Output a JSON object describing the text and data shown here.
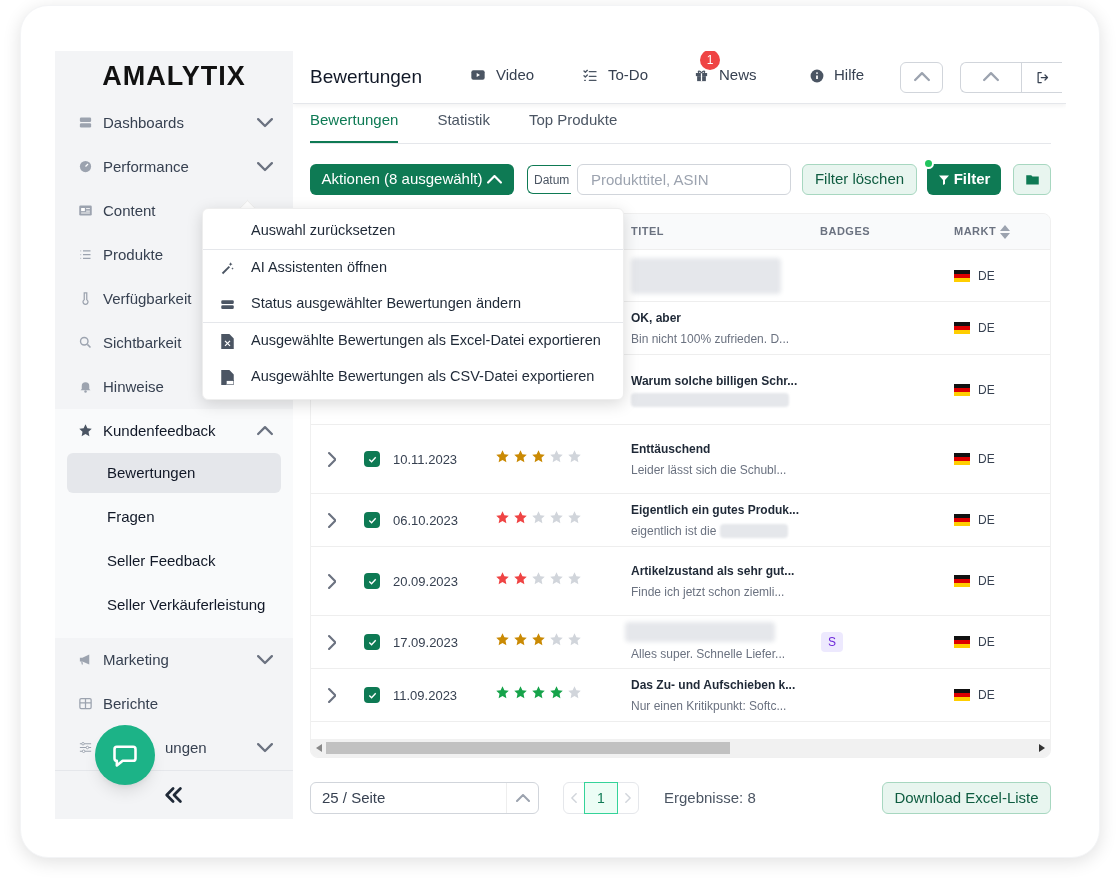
{
  "logo": "AMALYTIX",
  "sidebar": {
    "items": [
      {
        "label": "Dashboards",
        "kind": "group",
        "expanded": false
      },
      {
        "label": "Performance",
        "kind": "group",
        "expanded": false
      },
      {
        "label": "Content",
        "kind": "link"
      },
      {
        "label": "Produkte",
        "kind": "link"
      },
      {
        "label": "Verfügbarkeit",
        "kind": "link"
      },
      {
        "label": "Sichtbarkeit",
        "kind": "link"
      },
      {
        "label": "Hinweise",
        "kind": "link"
      },
      {
        "label": "Kundenfeedback",
        "kind": "group",
        "expanded": true,
        "children": [
          {
            "label": "Bewertungen",
            "selected": true
          },
          {
            "label": "Fragen",
            "selected": false
          },
          {
            "label": "Seller Feedback",
            "selected": false
          },
          {
            "label": "Seller Verkäuferleistung",
            "selected": false
          }
        ]
      },
      {
        "label": "Marketing",
        "kind": "group",
        "expanded": false
      },
      {
        "label": "Berichte",
        "kind": "link"
      },
      {
        "label": "ungen",
        "kind": "group",
        "expanded": false
      }
    ]
  },
  "header": {
    "title": "Bewertungen",
    "nav": [
      {
        "label": "Video"
      },
      {
        "label": "To-Do"
      },
      {
        "label": "News",
        "badge": "1"
      },
      {
        "label": "Hilfe"
      }
    ]
  },
  "tabs": [
    {
      "label": "Bewertungen",
      "selected": true
    },
    {
      "label": "Statistik",
      "selected": false
    },
    {
      "label": "Top Produkte",
      "selected": false
    }
  ],
  "toolbar": {
    "actions_button": "Aktionen (8 ausgewählt)",
    "date_field": "Datum",
    "search": {
      "placeholder": "Produkttitel, ASIN"
    },
    "clear_button": "Filter löschen",
    "filter_button": "Filter",
    "filter_active": true
  },
  "actions_menu": {
    "groups": [
      [
        {
          "label": "Auswahl zurücksetzen"
        }
      ],
      [
        {
          "label": "AI Assistenten öffnen"
        },
        {
          "label": "Status ausgewählter Bewertungen ändern"
        }
      ],
      [
        {
          "label": "Ausgewählte Bewertungen als Excel-Datei exportieren"
        },
        {
          "label": "Ausgewählte Bewertungen als CSV-Datei exportieren"
        }
      ]
    ]
  },
  "table": {
    "columns": [
      {
        "label": "TITEL",
        "sortable": false
      },
      {
        "label": "BADGES",
        "sortable": false
      },
      {
        "label": "MARKT",
        "sortable": true
      }
    ],
    "rows": [
      {
        "title_blur": true,
        "market": "DE"
      },
      {
        "title": "OK, aber",
        "snippet": "Bin nicht 100% zufrieden. D...",
        "market": "DE"
      },
      {
        "title": "Warum solche billigen Schr...",
        "snippet_blur": true,
        "market": "DE"
      },
      {
        "checked": true,
        "date": "10.11.2023",
        "stars": 3,
        "title": "Enttäuschend",
        "snippet": "Leider lässt sich die Schubl...",
        "market": "DE"
      },
      {
        "checked": true,
        "date": "06.10.2023",
        "stars": 2,
        "title": "Eigentlich ein gutes Produk...",
        "snippet": "eigentlich ist die",
        "snippet_blur": true,
        "market": "DE"
      },
      {
        "checked": true,
        "date": "20.09.2023",
        "stars": 2,
        "title": "Artikelzustand als sehr gut...",
        "snippet": "Finde ich jetzt schon ziemli...",
        "market": "DE"
      },
      {
        "checked": true,
        "date": "17.09.2023",
        "stars": 3,
        "title_blur": true,
        "snippet": "Alles super. Schnelle Liefer...",
        "badges": [
          "S"
        ],
        "market": "DE"
      },
      {
        "checked": true,
        "date": "11.09.2023",
        "stars": 4,
        "title": "Das Zu- und Aufschieben k...",
        "snippet": "Nur einen Kritikpunkt: Softc...",
        "market": "DE"
      }
    ]
  },
  "footer": {
    "page_size": "25 / Seite",
    "page": "1",
    "results": "Ergebnisse: 8",
    "download_button": "Download Excel-Liste"
  }
}
